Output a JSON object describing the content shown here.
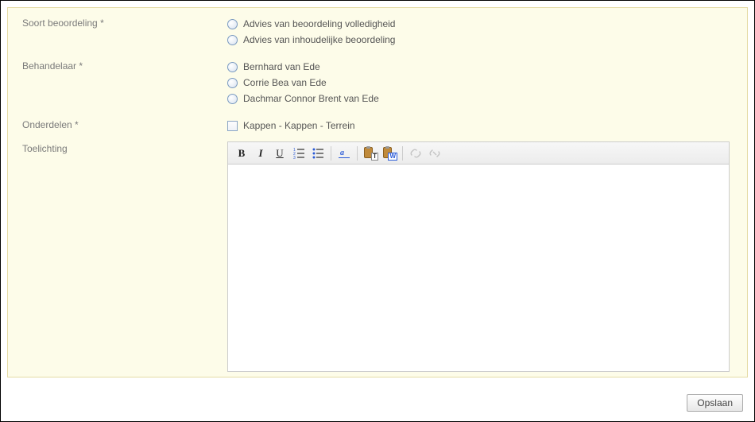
{
  "labels": {
    "soort": "Soort beoordeling *",
    "behandelaar": "Behandelaar *",
    "onderdelen": "Onderdelen *",
    "toelichting": "Toelichting"
  },
  "soort_options": [
    "Advies van beoordeling volledigheid",
    "Advies van inhoudelijke beoordeling"
  ],
  "behandelaar_options": [
    "Bernhard van Ede",
    "Corrie Bea van Ede",
    "Dachmar Connor Brent van Ede"
  ],
  "onderdelen_options": [
    "Kappen - Kappen - Terrein"
  ],
  "toolbar": {
    "bold": "B",
    "italic": "I",
    "underline": "U",
    "paste_text_badge": "T",
    "paste_word_badge": "W"
  },
  "editor_content": "",
  "buttons": {
    "save": "Opslaan"
  }
}
